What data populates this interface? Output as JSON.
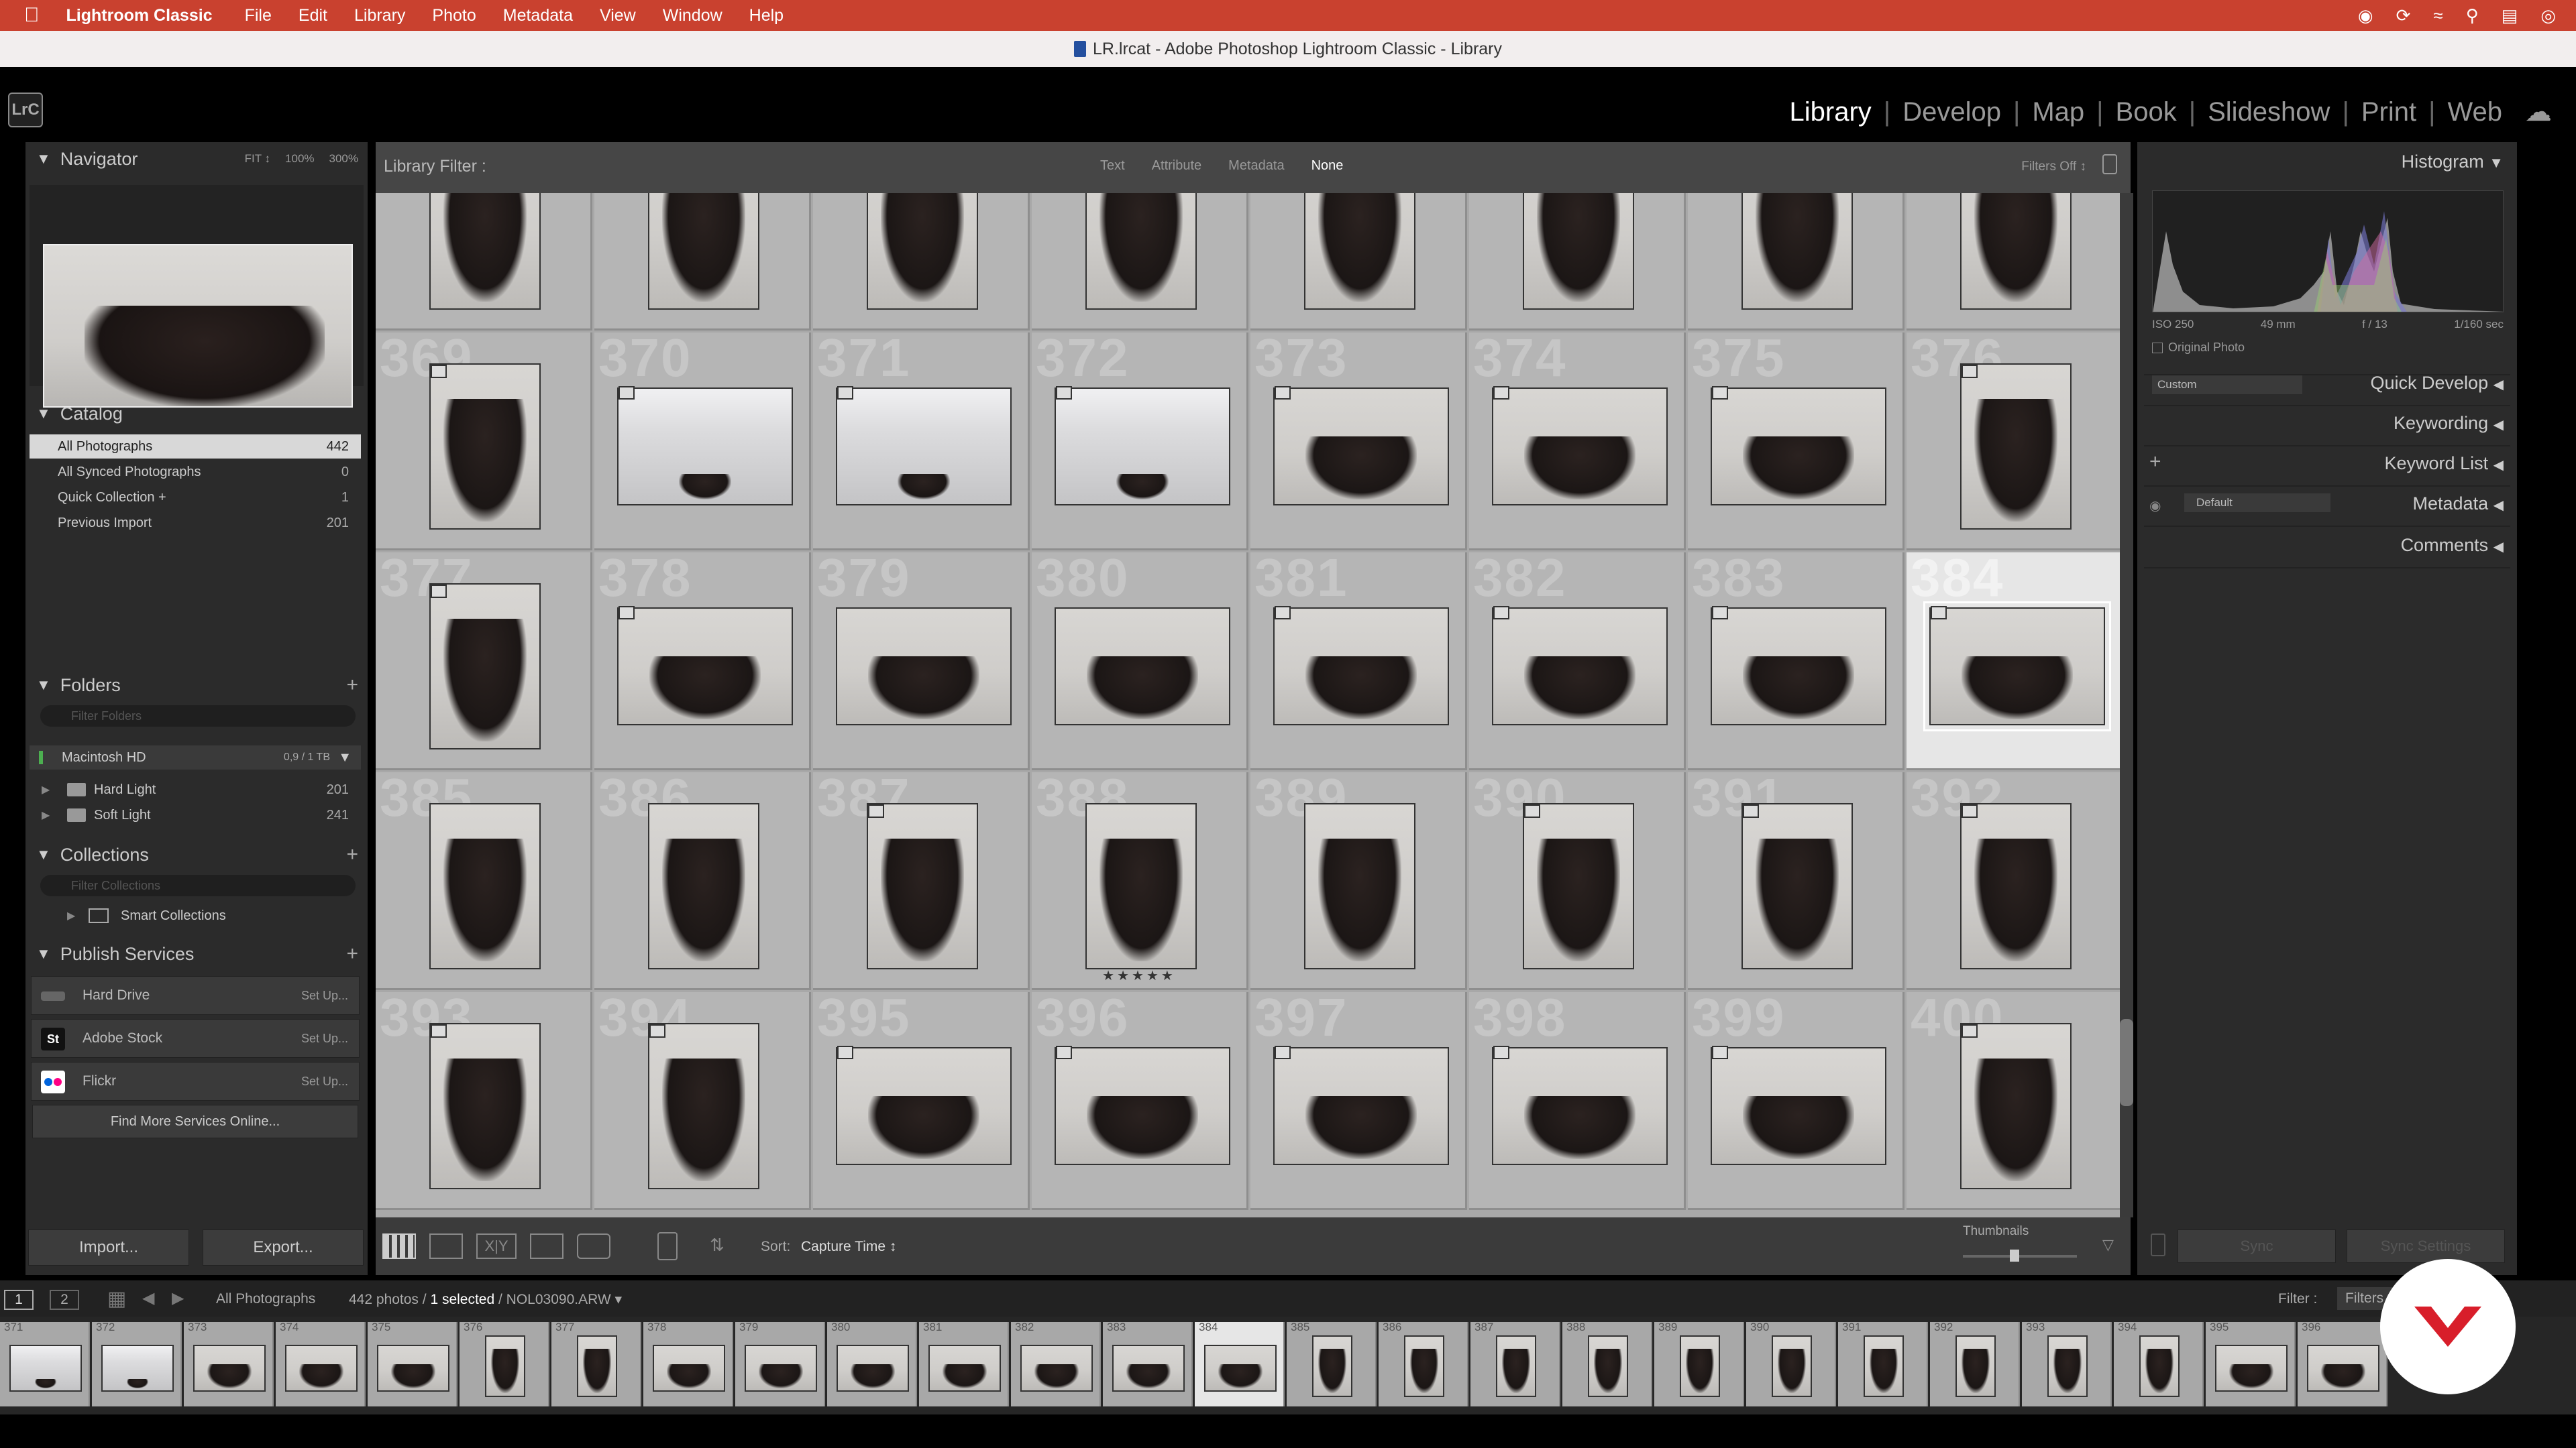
{
  "menubar": {
    "app": "Lightroom Classic",
    "items": [
      "File",
      "Edit",
      "Library",
      "Photo",
      "Metadata",
      "View",
      "Window",
      "Help"
    ],
    "tray_icons": [
      "creative-cloud-icon",
      "sync-icon",
      "wifi-off-icon",
      "spotlight-icon",
      "control-center-icon",
      "siri-icon"
    ]
  },
  "titlebar": {
    "title": "LR.lrcat - Adobe Photoshop Lightroom Classic - Library"
  },
  "identity": {
    "logo": "LrC"
  },
  "modules": [
    "Library",
    "Develop",
    "Map",
    "Book",
    "Slideshow",
    "Print",
    "Web"
  ],
  "active_module": "Library",
  "navigator": {
    "title": "Navigator",
    "zoom_fit": "FIT ↕",
    "zoom_100": "100%",
    "zoom_300": "300%"
  },
  "catalog": {
    "title": "Catalog",
    "items": [
      {
        "label": "All Photographs",
        "count": "442"
      },
      {
        "label": "All Synced Photographs",
        "count": "0"
      },
      {
        "label": "Quick Collection +",
        "count": "1"
      },
      {
        "label": "Previous Import",
        "count": "201"
      }
    ]
  },
  "folders": {
    "title": "Folders",
    "filter_placeholder": "Filter Folders",
    "volume": {
      "name": "Macintosh HD",
      "size": "0,9 / 1 TB"
    },
    "items": [
      {
        "label": "Hard Light",
        "count": "201"
      },
      {
        "label": "Soft Light",
        "count": "241"
      }
    ]
  },
  "collections": {
    "title": "Collections",
    "filter_placeholder": "Filter Collections",
    "items": [
      {
        "label": "Smart Collections"
      }
    ]
  },
  "publish": {
    "title": "Publish Services",
    "services": [
      {
        "label": "Hard Drive",
        "action": "Set Up..."
      },
      {
        "label": "Adobe Stock",
        "action": "Set Up...",
        "icon": "St"
      },
      {
        "label": "Flickr",
        "action": "Set Up..."
      }
    ],
    "find_more": "Find More Services Online..."
  },
  "buttons": {
    "import": "Import...",
    "export": "Export..."
  },
  "filterbar": {
    "title": "Library Filter :",
    "tabs": [
      "Text",
      "Attribute",
      "Metadata",
      "None"
    ],
    "active_tab": "None",
    "status": "Filters Off ↕"
  },
  "grid": {
    "rows": [
      {
        "cells": [
          {
            "n": "",
            "shape": "port"
          },
          {
            "n": "",
            "shape": "port"
          },
          {
            "n": "",
            "shape": "port"
          },
          {
            "n": "",
            "shape": "port"
          },
          {
            "n": "",
            "shape": "port"
          },
          {
            "n": "",
            "shape": "port"
          },
          {
            "n": "",
            "shape": "port"
          },
          {
            "n": "",
            "shape": "port"
          }
        ]
      },
      {
        "cells": [
          {
            "n": "369",
            "shape": "port",
            "badge": true
          },
          {
            "n": "370",
            "shape": "land",
            "room": true,
            "badge": true
          },
          {
            "n": "371",
            "shape": "land",
            "room": true,
            "badge": true
          },
          {
            "n": "372",
            "shape": "land",
            "room": true,
            "badge": true
          },
          {
            "n": "373",
            "shape": "land",
            "badge": true
          },
          {
            "n": "374",
            "shape": "land",
            "badge": true
          },
          {
            "n": "375",
            "shape": "land",
            "badge": true
          },
          {
            "n": "376",
            "shape": "port",
            "badge": true
          }
        ]
      },
      {
        "cells": [
          {
            "n": "377",
            "shape": "port",
            "badge": true
          },
          {
            "n": "378",
            "shape": "land",
            "badge": true
          },
          {
            "n": "379",
            "shape": "land"
          },
          {
            "n": "380",
            "shape": "land"
          },
          {
            "n": "381",
            "shape": "land",
            "badge": true
          },
          {
            "n": "382",
            "shape": "land",
            "badge": true
          },
          {
            "n": "383",
            "shape": "land",
            "badge": true
          },
          {
            "n": "384",
            "shape": "land",
            "badge": true,
            "selected": true
          }
        ]
      },
      {
        "cells": [
          {
            "n": "385",
            "shape": "port"
          },
          {
            "n": "386",
            "shape": "port"
          },
          {
            "n": "387",
            "shape": "port",
            "badge": true
          },
          {
            "n": "388",
            "shape": "port",
            "stars": "★★★★★"
          },
          {
            "n": "389",
            "shape": "port"
          },
          {
            "n": "390",
            "shape": "port",
            "badge": true
          },
          {
            "n": "391",
            "shape": "port",
            "badge": true
          },
          {
            "n": "392",
            "shape": "port",
            "badge": true
          }
        ]
      },
      {
        "cells": [
          {
            "n": "393",
            "shape": "port",
            "badge": true
          },
          {
            "n": "394",
            "shape": "port",
            "badge": true
          },
          {
            "n": "395",
            "shape": "land",
            "badge": true
          },
          {
            "n": "396",
            "shape": "land",
            "badge": true
          },
          {
            "n": "397",
            "shape": "land",
            "badge": true
          },
          {
            "n": "398",
            "shape": "land",
            "badge": true
          },
          {
            "n": "399",
            "shape": "land",
            "badge": true
          },
          {
            "n": "400",
            "shape": "port",
            "badge": true
          }
        ]
      }
    ]
  },
  "toolbar": {
    "sort_label": "Sort:",
    "sort_value": "Capture Time ↕",
    "thumbnails_label": "Thumbnails",
    "thumbnail_size": 0.45
  },
  "histogram": {
    "title": "Histogram",
    "iso": "ISO 250",
    "focal": "49 mm",
    "aperture": "f / 13",
    "shutter": "1/160 sec",
    "original_photo": "Original Photo"
  },
  "right_sections": {
    "saved_preset": "Custom",
    "quick_develop": "Quick Develop",
    "keywording": "Keywording",
    "keyword_list": "Keyword List",
    "metadata_preset": "Default",
    "metadata": "Metadata",
    "comments": "Comments"
  },
  "sync": {
    "sync": "Sync",
    "sync_settings": "Sync Settings"
  },
  "filmstrip": {
    "screens": [
      "1",
      "2"
    ],
    "source": "All Photographs",
    "info_prefix": "442 photos /",
    "info_selected": "1 selected",
    "info_file": "/ NOL03090.ARW ▾",
    "filter_label": "Filter :",
    "filter_value": "Filters",
    "frames": [
      "371",
      "372",
      "373",
      "374",
      "375",
      "376",
      "377",
      "378",
      "379",
      "380",
      "381",
      "382",
      "383",
      "384",
      "385",
      "386",
      "387",
      "388",
      "389",
      "390",
      "391",
      "392",
      "393",
      "394",
      "395",
      "396"
    ],
    "selected_frame": "384"
  },
  "colors": {
    "menubar": "#c9412f",
    "grid_bg": "#a8a8a8",
    "selected_cell": "#e6e6e6",
    "logo_red": "#d81e2a"
  }
}
